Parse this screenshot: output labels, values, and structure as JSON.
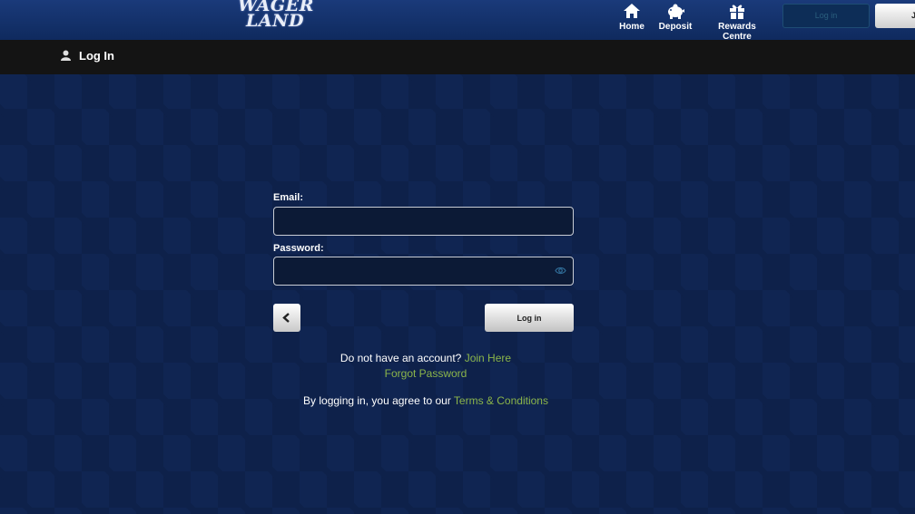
{
  "header": {
    "logo_line1": "WAGER",
    "logo_line2": "LAND",
    "nav": [
      {
        "label": "Home",
        "icon": "home-icon"
      },
      {
        "label": "Deposit",
        "icon": "piggy-bank-icon"
      },
      {
        "label": "Rewards Centre",
        "icon": "gift-icon"
      }
    ],
    "login_label": "Log in",
    "join_label": "J"
  },
  "titlebar": {
    "icon": "user-icon",
    "title": "Log In"
  },
  "form": {
    "email_label": "Email:",
    "email_value": "",
    "password_label": "Password:",
    "password_value": "",
    "password_toggle_icon": "eye-icon",
    "back_icon": "chevron-left-icon",
    "login_button": "Log in"
  },
  "links": {
    "no_account_text": "Do not have an account?",
    "join_link": "Join Here",
    "forgot_link": "Forgot Password",
    "terms_text": "By logging in, you agree to our",
    "terms_link": "Terms & Conditions"
  },
  "colors": {
    "background": "#102552",
    "link": "#8bb54a",
    "titlebar": "#141414"
  }
}
